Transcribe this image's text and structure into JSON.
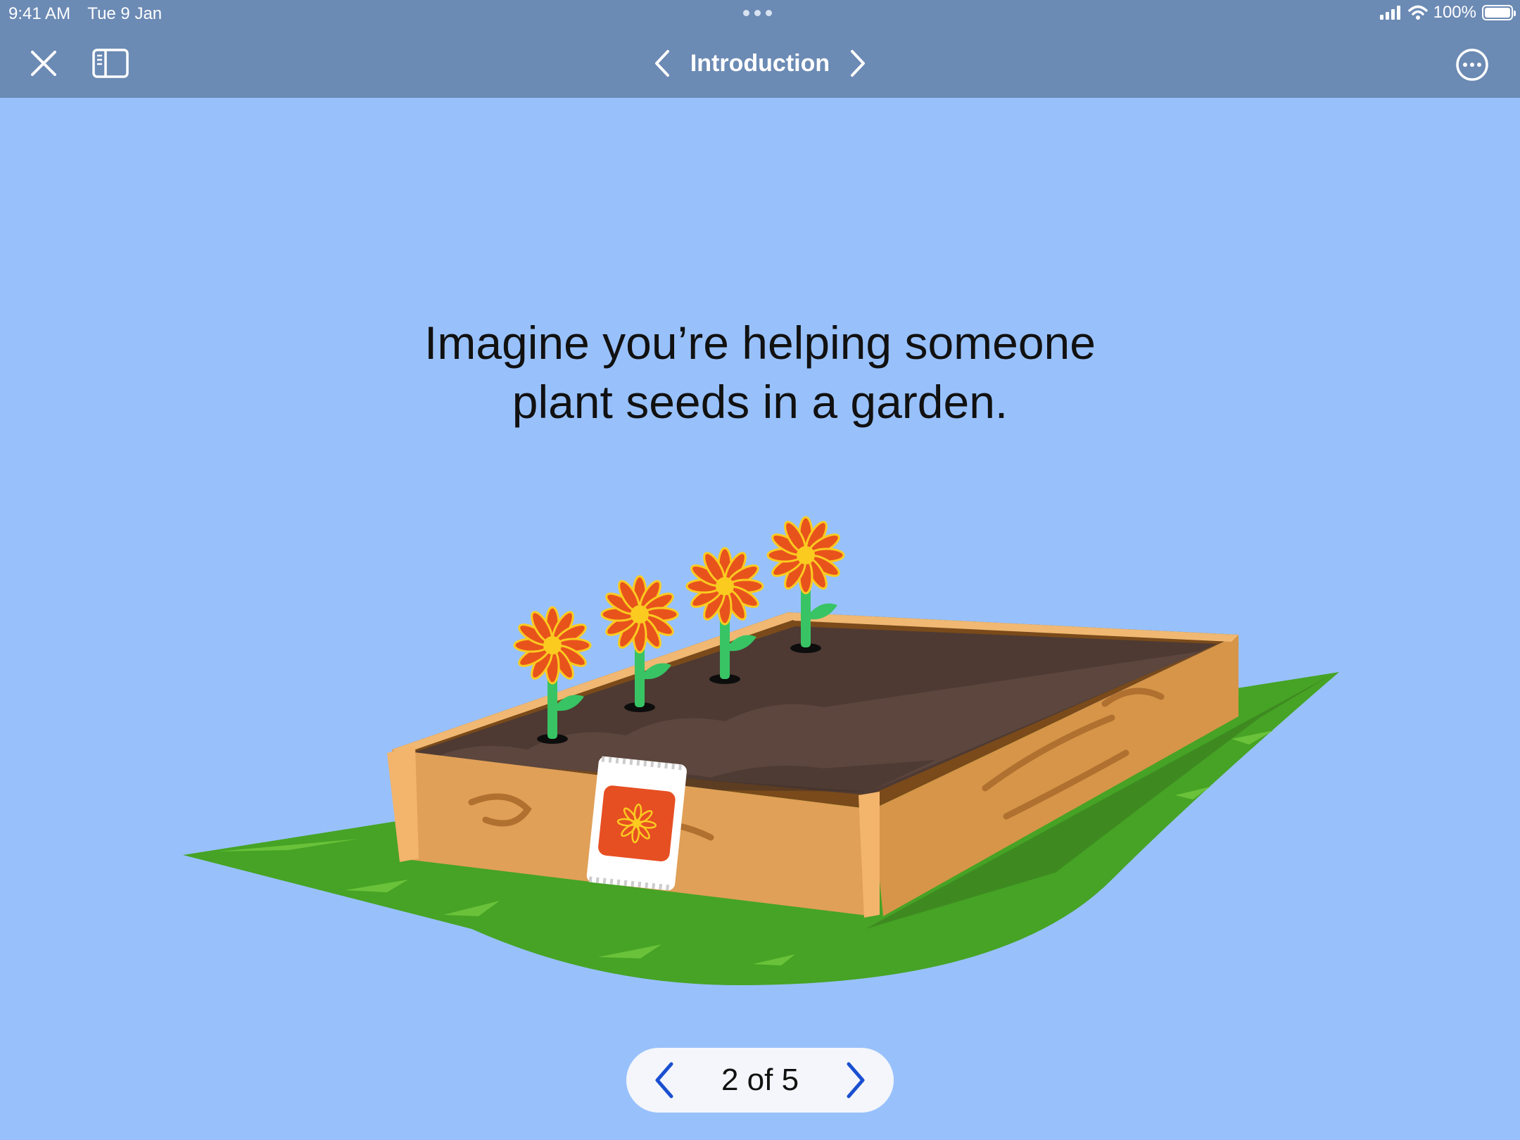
{
  "status_bar": {
    "time": "9:41 AM",
    "date": "Tue 9 Jan",
    "battery": "100%",
    "icons": [
      "signal-icon",
      "wifi-icon",
      "battery-icon"
    ]
  },
  "nav": {
    "title": "Introduction",
    "icons": [
      "close-icon",
      "sidebar-icon",
      "chevron-left-icon",
      "chevron-right-icon",
      "more-icon"
    ]
  },
  "content": {
    "headline_line1": "Imagine you’re helping someone",
    "headline_line2": "plant seeds in a garden."
  },
  "pager": {
    "label": "2 of 5",
    "current": 2,
    "total": 5
  },
  "colors": {
    "background": "#98c1fc",
    "top_bar": "#6b8ab4",
    "pager_arrow": "#1a4fd1",
    "grass": "#46a325",
    "wood": "#e0a057",
    "petal": "#e8531c",
    "flower_center": "#fbcb20"
  }
}
